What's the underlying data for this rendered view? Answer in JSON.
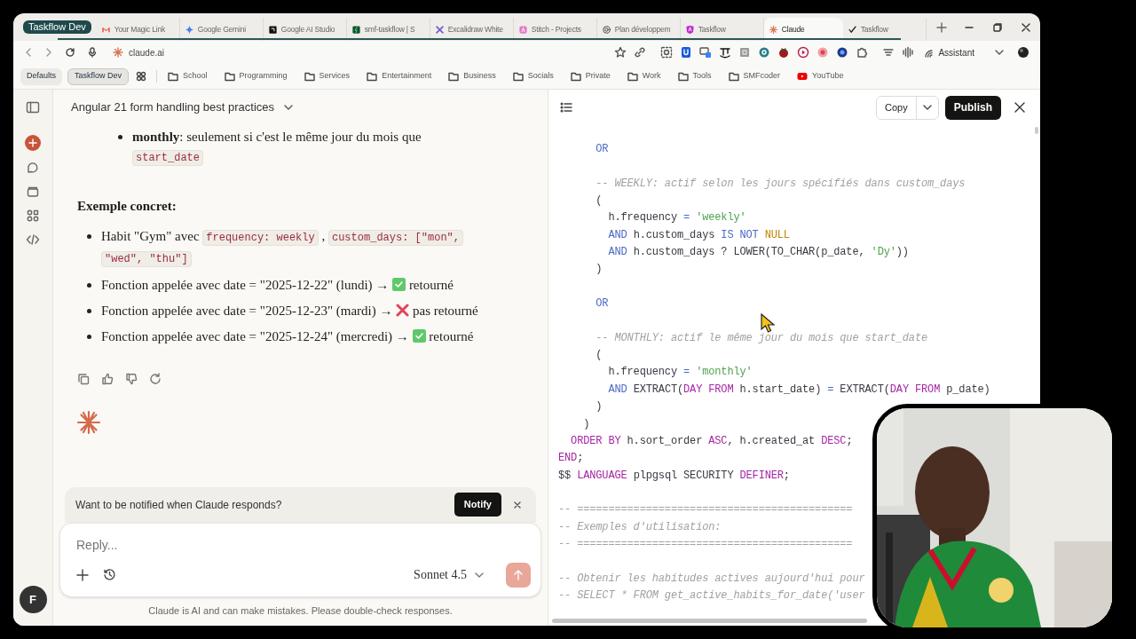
{
  "browser": {
    "tab_group": "Taskflow Dev",
    "tabs": [
      {
        "title": "Your Magic Link",
        "selected": false
      },
      {
        "title": "Google Gemini",
        "selected": false
      },
      {
        "title": "Google AI Studio",
        "selected": false
      },
      {
        "title": "smf-taskflow | S",
        "selected": false
      },
      {
        "title": "Excalidraw White",
        "selected": false
      },
      {
        "title": "Stitch - Projects",
        "selected": false
      },
      {
        "title": "Plan développem",
        "selected": false
      },
      {
        "title": "Taskflow",
        "selected": false
      },
      {
        "title": "Claude",
        "selected": true
      },
      {
        "title": "Taskflow",
        "selected": false
      }
    ],
    "url": "claude.ai",
    "assistant": "Assistant",
    "profiles": [
      {
        "label": "Defaults",
        "selected": false
      },
      {
        "label": "Taskflow Dev",
        "selected": true
      }
    ],
    "bookmarks": [
      {
        "label": "School",
        "kind": "folder"
      },
      {
        "label": "Programming",
        "kind": "folder"
      },
      {
        "label": "Services",
        "kind": "folder"
      },
      {
        "label": "Entertainment",
        "kind": "folder"
      },
      {
        "label": "Business",
        "kind": "folder"
      },
      {
        "label": "Socials",
        "kind": "folder"
      },
      {
        "label": "Private",
        "kind": "folder"
      },
      {
        "label": "Work",
        "kind": "folder"
      },
      {
        "label": "Tools",
        "kind": "folder"
      },
      {
        "label": "SMFcoder",
        "kind": "folder"
      },
      {
        "label": "YouTube",
        "kind": "video"
      }
    ]
  },
  "sidebar": {
    "avatar": "F"
  },
  "chat": {
    "title": "Angular 21 form handling best practices",
    "blocks": [
      {
        "kind": "sublist",
        "items": [
          [
            {
              "kind": "text",
              "text": "**monthly**: seulement si c'est le même jour du mois que"
            },
            {
              "kind": "code",
              "text": "start_date"
            }
          ]
        ]
      },
      {
        "kind": "heading",
        "text": "Exemple concret:"
      },
      {
        "kind": "list",
        "items": [
          [
            {
              "kind": "text",
              "text": "Habit \"Gym\" avec"
            },
            {
              "kind": "code",
              "text": "frequency: weekly"
            },
            {
              "kind": "text",
              "text": ","
            },
            {
              "kind": "code",
              "text": "custom_days: [\"mon\", \"wed\", \"thu\"]"
            }
          ],
          [
            {
              "kind": "text",
              "text": "Fonction appelée avec date = \"2025-12-22\" (lundi) →"
            },
            {
              "kind": "check"
            },
            {
              "kind": "text",
              "text": "retourné"
            }
          ],
          [
            {
              "kind": "text",
              "text": "Fonction appelée avec date = \"2025-12-23\" (mardi) →"
            },
            {
              "kind": "cross"
            },
            {
              "kind": "text",
              "text": "pas retourné"
            }
          ],
          [
            {
              "kind": "text",
              "text": "Fonction appelée avec date = \"2025-12-24\" (mercredi) →"
            },
            {
              "kind": "check"
            },
            {
              "kind": "text",
              "text": "retourné"
            }
          ]
        ]
      }
    ],
    "notify": {
      "text": "Want to be notified when Claude responds?",
      "button": "Notify"
    },
    "reply": {
      "placeholder": "Reply...",
      "model": "Sonnet 4.5",
      "send_disabled": true
    },
    "disclaimer": "Claude is AI and can make mistakes. Please double-check responses."
  },
  "artifact": {
    "copy": "Copy",
    "publish": "Publish",
    "lines": [
      {
        "kind": "code",
        "tokens": [
          {
            "kind": "op",
            "text": "      OR"
          }
        ]
      },
      {
        "kind": "blank"
      },
      {
        "kind": "code",
        "tokens": [
          {
            "kind": "cmt",
            "text": "      -- WEEKLY: actif selon les jours spécifiés dans custom_days"
          }
        ]
      },
      {
        "kind": "code",
        "tokens": [
          {
            "kind": "txt",
            "text": "      ("
          }
        ]
      },
      {
        "kind": "code",
        "tokens": [
          {
            "kind": "txt",
            "text": "        h.frequency "
          },
          {
            "kind": "op",
            "text": "= "
          },
          {
            "kind": "str",
            "text": "'weekly'"
          }
        ]
      },
      {
        "kind": "code",
        "tokens": [
          {
            "kind": "op",
            "text": "        AND"
          },
          {
            "kind": "txt",
            "text": " h.custom_days "
          },
          {
            "kind": "op",
            "text": "IS NOT "
          },
          {
            "kind": "lit",
            "text": "NULL"
          }
        ]
      },
      {
        "kind": "code",
        "tokens": [
          {
            "kind": "op",
            "text": "        AND"
          },
          {
            "kind": "txt",
            "text": " h.custom_days ? LOWER(TO_CHAR(p_date, "
          },
          {
            "kind": "str",
            "text": "'Dy'"
          },
          {
            "kind": "txt",
            "text": "))"
          }
        ]
      },
      {
        "kind": "code",
        "tokens": [
          {
            "kind": "txt",
            "text": "      )"
          }
        ]
      },
      {
        "kind": "blank"
      },
      {
        "kind": "code",
        "tokens": [
          {
            "kind": "op",
            "text": "      OR"
          }
        ]
      },
      {
        "kind": "blank"
      },
      {
        "kind": "code",
        "tokens": [
          {
            "kind": "cmt",
            "text": "      -- MONTHLY: actif le même jour du mois que start_date"
          }
        ]
      },
      {
        "kind": "code",
        "tokens": [
          {
            "kind": "txt",
            "text": "      ("
          }
        ]
      },
      {
        "kind": "code",
        "tokens": [
          {
            "kind": "txt",
            "text": "        h.frequency "
          },
          {
            "kind": "op",
            "text": "= "
          },
          {
            "kind": "str",
            "text": "'monthly'"
          }
        ]
      },
      {
        "kind": "code",
        "tokens": [
          {
            "kind": "op",
            "text": "        AND"
          },
          {
            "kind": "txt",
            "text": " EXTRACT("
          },
          {
            "kind": "kw",
            "text": "DAY FROM"
          },
          {
            "kind": "txt",
            "text": " h.start_date) "
          },
          {
            "kind": "op",
            "text": "="
          },
          {
            "kind": "txt",
            "text": " EXTRACT("
          },
          {
            "kind": "kw",
            "text": "DAY FROM"
          },
          {
            "kind": "txt",
            "text": " p_date)"
          }
        ]
      },
      {
        "kind": "code",
        "tokens": [
          {
            "kind": "txt",
            "text": "      )"
          }
        ]
      },
      {
        "kind": "code",
        "tokens": [
          {
            "kind": "txt",
            "text": "    )"
          }
        ]
      },
      {
        "kind": "code",
        "tokens": [
          {
            "kind": "kw",
            "text": "  ORDER BY"
          },
          {
            "kind": "txt",
            "text": " h.sort_order "
          },
          {
            "kind": "kw",
            "text": "ASC"
          },
          {
            "kind": "txt",
            "text": ", h.created_at "
          },
          {
            "kind": "kw",
            "text": "DESC"
          },
          {
            "kind": "txt",
            "text": ";"
          }
        ]
      },
      {
        "kind": "code",
        "tokens": [
          {
            "kind": "kw",
            "text": "END"
          },
          {
            "kind": "txt",
            "text": ";"
          }
        ]
      },
      {
        "kind": "code",
        "tokens": [
          {
            "kind": "txt",
            "text": "$$ "
          },
          {
            "kind": "kw",
            "text": "LANGUAGE"
          },
          {
            "kind": "txt",
            "text": " plpgsql SECURITY "
          },
          {
            "kind": "kw",
            "text": "DEFINER"
          },
          {
            "kind": "txt",
            "text": ";"
          }
        ]
      },
      {
        "kind": "blank"
      },
      {
        "kind": "code",
        "tokens": [
          {
            "kind": "cmt",
            "text": "-- ============================================"
          }
        ]
      },
      {
        "kind": "code",
        "tokens": [
          {
            "kind": "cmt",
            "text": "-- Exemples d'utilisation:"
          }
        ]
      },
      {
        "kind": "code",
        "tokens": [
          {
            "kind": "cmt",
            "text": "-- ============================================"
          }
        ]
      },
      {
        "kind": "blank"
      },
      {
        "kind": "code",
        "tokens": [
          {
            "kind": "cmt",
            "text": "-- Obtenir les habitudes actives aujourd'hui pour"
          }
        ]
      },
      {
        "kind": "code",
        "tokens": [
          {
            "kind": "cmt",
            "text": "-- SELECT * FROM get_active_habits_for_date('user"
          }
        ]
      }
    ]
  }
}
